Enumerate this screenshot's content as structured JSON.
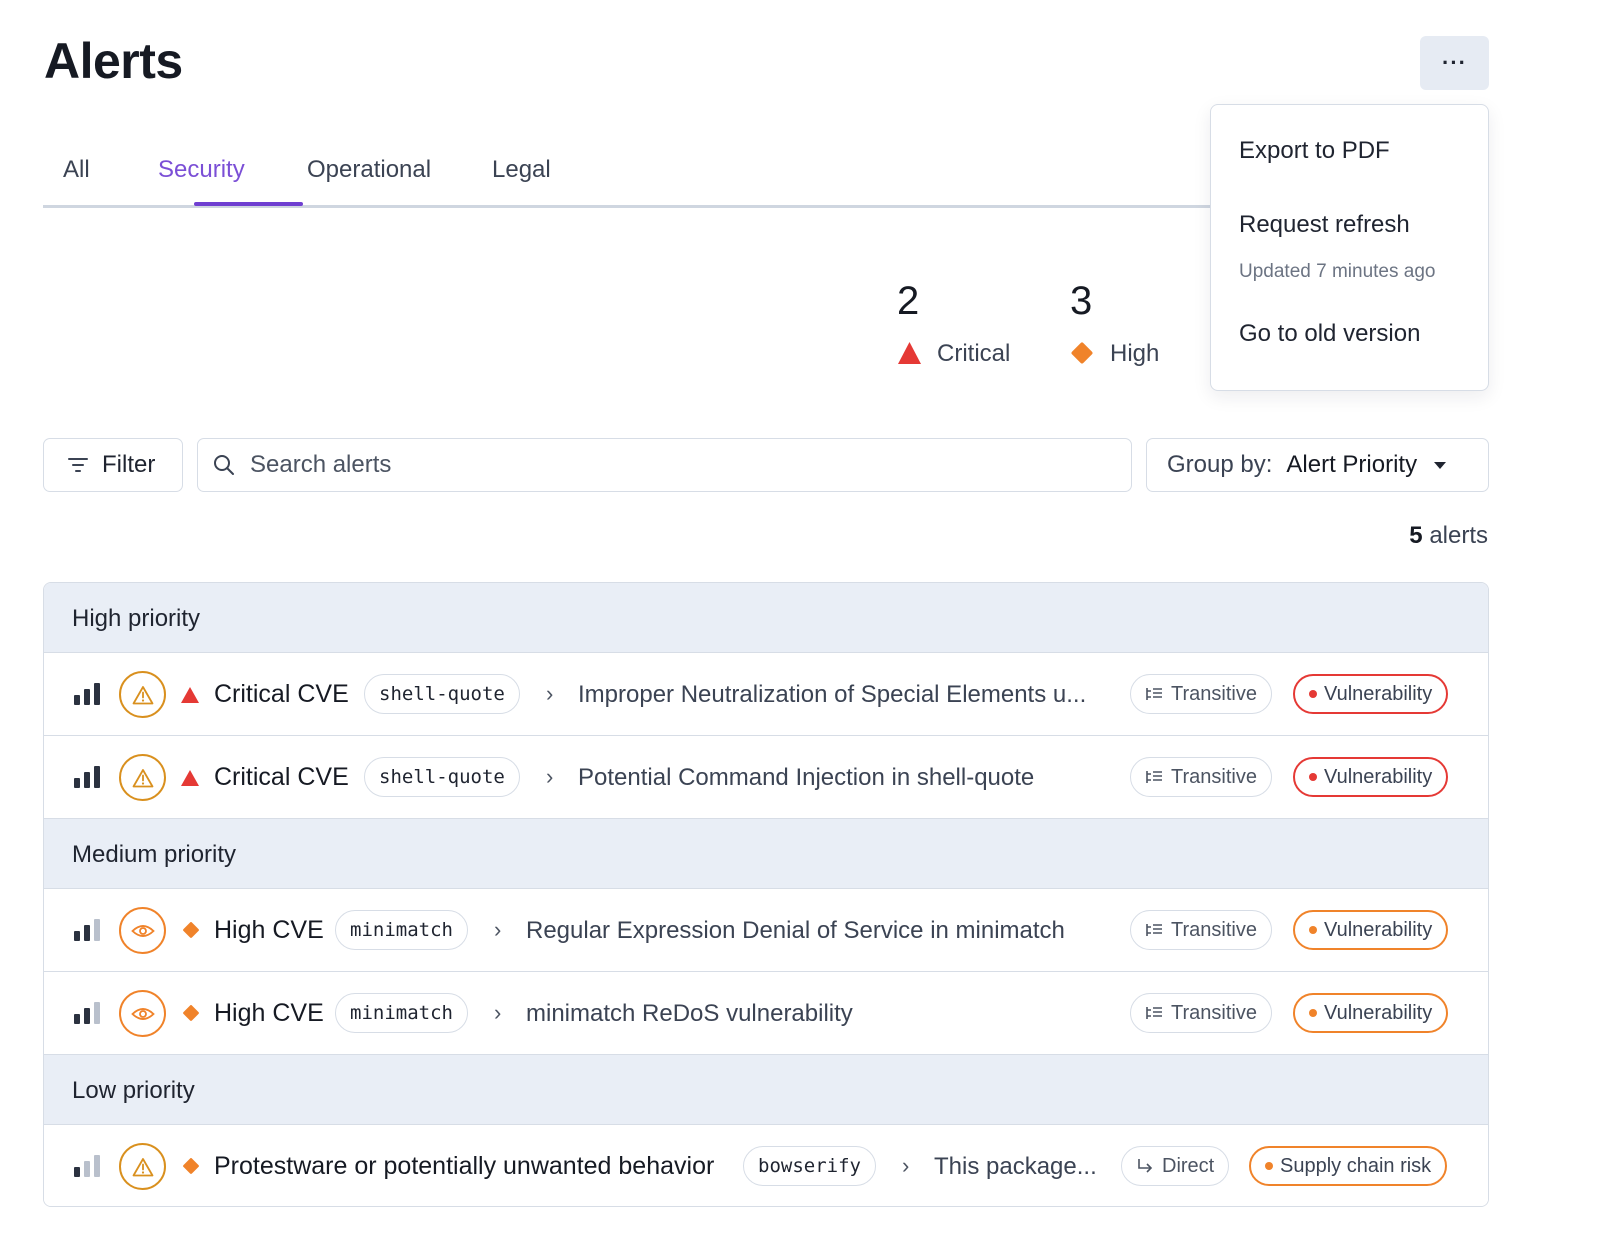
{
  "header": {
    "title": "Alerts",
    "more_label": "···"
  },
  "tabs": [
    {
      "label": "All",
      "active": false
    },
    {
      "label": "Security",
      "active": true
    },
    {
      "label": "Operational",
      "active": false
    },
    {
      "label": "Legal",
      "active": false
    }
  ],
  "menu": {
    "export": "Export to PDF",
    "refresh": "Request refresh",
    "updated": "Updated 7 minutes ago",
    "old_version": "Go to old version"
  },
  "stats": {
    "critical": {
      "count": "2",
      "label": "Critical",
      "icon": "triangle-icon",
      "color": "#e53935"
    },
    "high": {
      "count": "3",
      "label": "High",
      "icon": "diamond-icon",
      "color": "#f0832a"
    }
  },
  "toolbar": {
    "filter_label": "Filter",
    "search_placeholder": "Search alerts",
    "group_by_label": "Group by:",
    "group_by_value": "Alert Priority"
  },
  "summary": {
    "count": "5",
    "suffix": "alerts"
  },
  "groups": {
    "high": {
      "label": "High priority"
    },
    "medium": {
      "label": "Medium priority"
    },
    "low": {
      "label": "Low priority"
    }
  },
  "alerts": [
    {
      "title": "Critical CVE",
      "package": "shell-quote",
      "description": "Improper Neutralization of Special Elements u...",
      "dependency": "Transitive",
      "type": "Vulnerability",
      "severity": "critical",
      "status_icon": "warning-icon"
    },
    {
      "title": "Critical CVE",
      "package": "shell-quote",
      "description": "Potential Command Injection in shell-quote",
      "dependency": "Transitive",
      "type": "Vulnerability",
      "severity": "critical",
      "status_icon": "warning-icon"
    },
    {
      "title": "High CVE",
      "package": "minimatch",
      "description": "Regular Expression Denial of Service in minimatch",
      "dependency": "Transitive",
      "type": "Vulnerability",
      "severity": "high",
      "status_icon": "eye-icon"
    },
    {
      "title": "High CVE",
      "package": "minimatch",
      "description": "minimatch ReDoS vulnerability",
      "dependency": "Transitive",
      "type": "Vulnerability",
      "severity": "high",
      "status_icon": "eye-icon"
    },
    {
      "title": "Protestware or potentially unwanted behavior",
      "package": "bowserify",
      "description": "This package...",
      "dependency": "Direct",
      "type": "Supply chain risk",
      "severity": "high",
      "status_icon": "warning-icon"
    }
  ],
  "colors": {
    "accent": "#6f3fd1",
    "critical": "#e53935",
    "high": "#f0832a",
    "status_amber": "#d9901e"
  }
}
